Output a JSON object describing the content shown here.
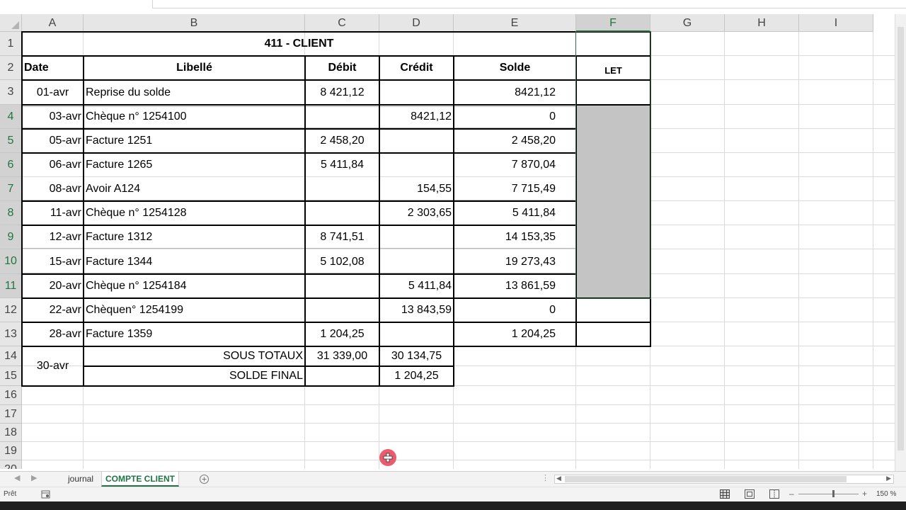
{
  "columns": [
    "A",
    "B",
    "C",
    "D",
    "E",
    "F",
    "G",
    "H",
    "I"
  ],
  "rows": [
    "1",
    "2",
    "3",
    "4",
    "5",
    "6",
    "7",
    "8",
    "9",
    "10",
    "11",
    "12",
    "13",
    "14",
    "15",
    "16",
    "17",
    "18",
    "19",
    "20"
  ],
  "sheet": {
    "title": "411 - CLIENT",
    "headers": {
      "date": "Date",
      "libelle": "Libellé",
      "debit": "Débit",
      "credit": "Crédit",
      "solde": "Solde",
      "let": "LET"
    },
    "entries": [
      {
        "date": "01-avr",
        "libelle": "Reprise du solde",
        "debit": "8 421,12",
        "credit": "",
        "solde": "8421,12"
      },
      {
        "date": "03-avr",
        "libelle": "Chèque n° 1254100",
        "debit": "",
        "credit": "8421,12",
        "solde": "0"
      },
      {
        "date": "05-avr",
        "libelle": "Facture 1251",
        "debit": "2 458,20",
        "credit": "",
        "solde": "2 458,20"
      },
      {
        "date": "06-avr",
        "libelle": "Facture 1265",
        "debit": "5 411,84",
        "credit": "",
        "solde": "7 870,04"
      },
      {
        "date": "08-avr",
        "libelle": "Avoir A124",
        "debit": "",
        "credit": "154,55",
        "solde": "7 715,49"
      },
      {
        "date": "11-avr",
        "libelle": "Chèque n° 1254128",
        "debit": "",
        "credit": "2 303,65",
        "solde": "5 411,84"
      },
      {
        "date": "12-avr",
        "libelle": "Facture 1312",
        "debit": "8 741,51",
        "credit": "",
        "solde": "14 153,35"
      },
      {
        "date": "15-avr",
        "libelle": "Facture 1344",
        "debit": "5 102,08",
        "credit": "",
        "solde": "19 273,43"
      },
      {
        "date": "20-avr",
        "libelle": "Chèque n° 1254184",
        "debit": "",
        "credit": "5 411,84",
        "solde": "13 861,59"
      },
      {
        "date": "22-avr",
        "libelle": "Chèquen° 1254199",
        "debit": "",
        "credit": "13 843,59",
        "solde": "0"
      },
      {
        "date": "28-avr",
        "libelle": "Facture 1359",
        "debit": "1 204,25",
        "credit": "",
        "solde": "1 204,25"
      }
    ],
    "totals": {
      "date": "30-avr",
      "sous_totaux_label": "SOUS TOTAUX",
      "sous_totaux_debit": "31 339,00",
      "sous_totaux_credit": "30 134,75",
      "solde_final_label": "SOLDE FINAL",
      "solde_final_credit": "1 204,25"
    }
  },
  "tabs": [
    {
      "label": "journal",
      "active": false
    },
    {
      "label": "COMPTE CLIENT",
      "active": true
    }
  ],
  "status": {
    "ready": "Prêt",
    "zoom": "150 %"
  },
  "colors": {
    "accent": "#217346",
    "shade": "#c4c4c4",
    "cursor": "#e85c6d"
  },
  "icons": [
    "add-sheet-icon",
    "normal-view-icon",
    "page-layout-icon",
    "page-break-icon",
    "macro-record-icon",
    "cursor-crosshair-icon"
  ]
}
